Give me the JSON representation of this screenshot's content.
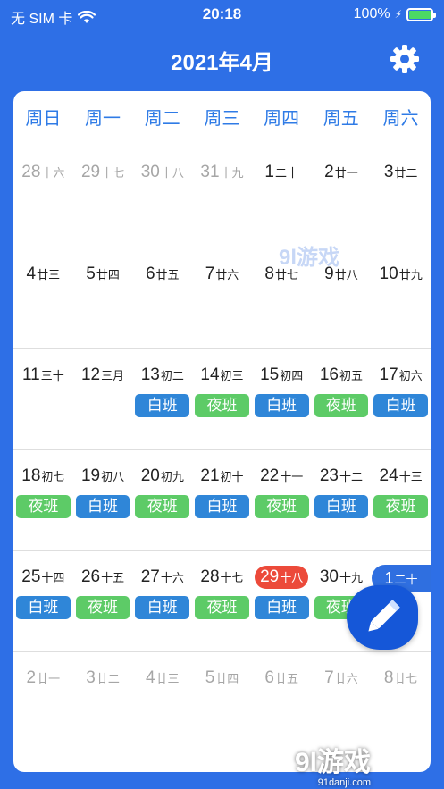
{
  "status_bar": {
    "carrier": "无 SIM 卡",
    "time": "20:18",
    "battery": "100%",
    "battery_level": 1.0
  },
  "header": {
    "title": "2021年4月",
    "settings_icon": "gear-icon"
  },
  "weekdays": [
    "周日",
    "周一",
    "周二",
    "周三",
    "周四",
    "周五",
    "周六"
  ],
  "weeks": [
    [
      {
        "num": "28",
        "lunar": "十六",
        "dim": true
      },
      {
        "num": "29",
        "lunar": "十七",
        "dim": true
      },
      {
        "num": "30",
        "lunar": "十八",
        "dim": true
      },
      {
        "num": "31",
        "lunar": "十九",
        "dim": true
      },
      {
        "num": "1",
        "lunar": "二十"
      },
      {
        "num": "2",
        "lunar": "廿一"
      },
      {
        "num": "3",
        "lunar": "廿二"
      }
    ],
    [
      {
        "num": "4",
        "lunar": "廿三"
      },
      {
        "num": "5",
        "lunar": "廿四"
      },
      {
        "num": "6",
        "lunar": "廿五"
      },
      {
        "num": "7",
        "lunar": "廿六"
      },
      {
        "num": "8",
        "lunar": "廿七"
      },
      {
        "num": "9",
        "lunar": "廿八"
      },
      {
        "num": "10",
        "lunar": "廿九"
      }
    ],
    [
      {
        "num": "11",
        "lunar": "三十"
      },
      {
        "num": "12",
        "lunar": "三月"
      },
      {
        "num": "13",
        "lunar": "初二",
        "shift": "白班",
        "shift_type": "day"
      },
      {
        "num": "14",
        "lunar": "初三",
        "shift": "夜班",
        "shift_type": "night"
      },
      {
        "num": "15",
        "lunar": "初四",
        "shift": "白班",
        "shift_type": "day"
      },
      {
        "num": "16",
        "lunar": "初五",
        "shift": "夜班",
        "shift_type": "night"
      },
      {
        "num": "17",
        "lunar": "初六",
        "shift": "白班",
        "shift_type": "day"
      }
    ],
    [
      {
        "num": "18",
        "lunar": "初七",
        "shift": "夜班",
        "shift_type": "night"
      },
      {
        "num": "19",
        "lunar": "初八",
        "shift": "白班",
        "shift_type": "day"
      },
      {
        "num": "20",
        "lunar": "初九",
        "shift": "夜班",
        "shift_type": "night"
      },
      {
        "num": "21",
        "lunar": "初十",
        "shift": "白班",
        "shift_type": "day"
      },
      {
        "num": "22",
        "lunar": "十一",
        "shift": "夜班",
        "shift_type": "night"
      },
      {
        "num": "23",
        "lunar": "十二",
        "shift": "白班",
        "shift_type": "day"
      },
      {
        "num": "24",
        "lunar": "十三",
        "shift": "夜班",
        "shift_type": "night"
      }
    ],
    [
      {
        "num": "25",
        "lunar": "十四",
        "shift": "白班",
        "shift_type": "day"
      },
      {
        "num": "26",
        "lunar": "十五",
        "shift": "夜班",
        "shift_type": "night"
      },
      {
        "num": "27",
        "lunar": "十六",
        "shift": "白班",
        "shift_type": "day"
      },
      {
        "num": "28",
        "lunar": "十七",
        "shift": "夜班",
        "shift_type": "night"
      },
      {
        "num": "29",
        "lunar": "十八",
        "shift": "白班",
        "shift_type": "day",
        "today": true
      },
      {
        "num": "30",
        "lunar": "十九",
        "shift": "夜班",
        "shift_type": "night"
      },
      {
        "num": "",
        "lunar": ""
      }
    ],
    [
      {
        "num": "2",
        "lunar": "廿一",
        "dim": true
      },
      {
        "num": "3",
        "lunar": "廿二",
        "dim": true
      },
      {
        "num": "4",
        "lunar": "廿三",
        "dim": true
      },
      {
        "num": "5",
        "lunar": "廿四",
        "dim": true
      },
      {
        "num": "6",
        "lunar": "廿五",
        "dim": true
      },
      {
        "num": "7",
        "lunar": "廿六",
        "dim": true
      },
      {
        "num": "8",
        "lunar": "廿七",
        "dim": true
      }
    ]
  ],
  "fab": {
    "pill_num": "1",
    "pill_lunar": "二十",
    "icon": "pencil-icon"
  },
  "watermarks": {
    "center": "9l游戏",
    "corner": "9l游戏",
    "corner_url": "91danji.com"
  },
  "colors": {
    "background": "#2e6fe6",
    "weekday": "#2f7be6",
    "day_shift": "#2f86d8",
    "night_shift": "#5dcb67",
    "today": "#ec4a3a"
  }
}
